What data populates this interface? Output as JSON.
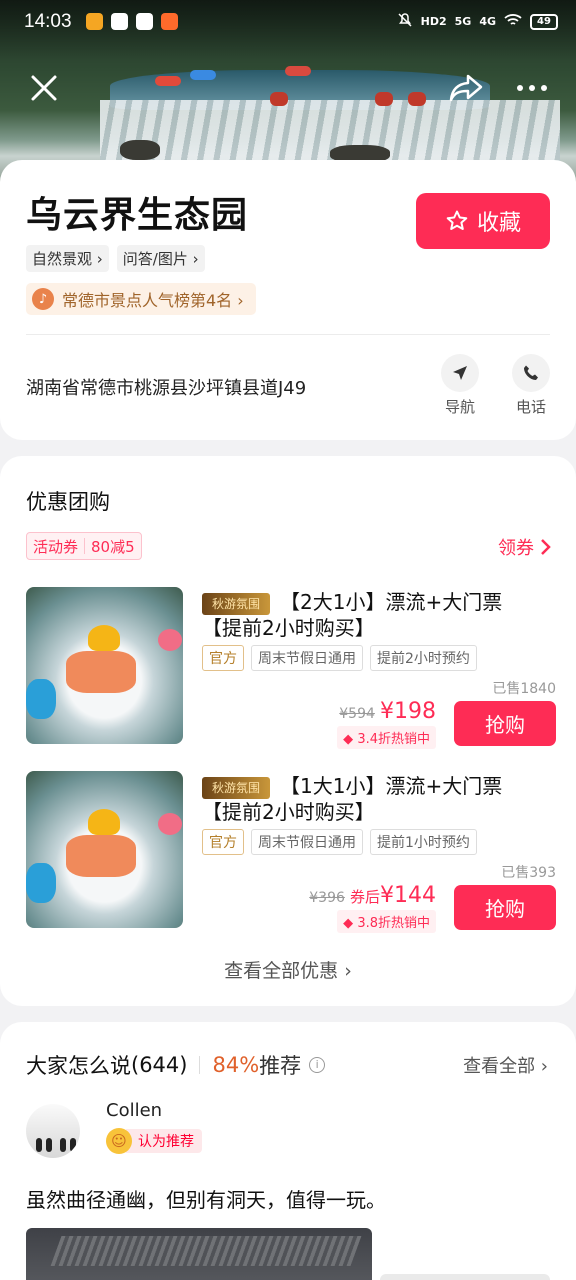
{
  "status_bar": {
    "time": "14:03",
    "battery": "49",
    "signal_labels": [
      "HD2",
      "5G",
      "4G"
    ]
  },
  "place": {
    "name": "乌云界生态园",
    "favorite_label": "收藏",
    "tags": [
      "自然景观 ›",
      "问答/图片 ›"
    ],
    "rank_text": "常德市景点人气榜第4名 ›",
    "address": "湖南省常德市桃源县沙坪镇县道J49",
    "actions": [
      {
        "label": "导航"
      },
      {
        "label": "电话"
      }
    ]
  },
  "deals_section": {
    "title": "优惠团购",
    "coupon_type": "活动券",
    "coupon_value": "80减5",
    "get_coupon": "领券",
    "deals": [
      {
        "logo_text": "秋游氛围",
        "title": "【2大1小】漂流+大门票【提前2小时购买】",
        "tags": [
          "官方",
          "周末节假日通用",
          "提前2小时预约"
        ],
        "sold": "已售1840",
        "orig_price": "¥594",
        "price_prefix": "",
        "price": "¥198",
        "discount": "3.4折热销中",
        "buy_label": "抢购"
      },
      {
        "logo_text": "秋游氛围",
        "title": "【1大1小】漂流+大门票【提前2小时购买】",
        "tags": [
          "官方",
          "周末节假日通用",
          "提前1小时预约"
        ],
        "sold": "已售393",
        "orig_price": "¥396",
        "price_prefix": "券后",
        "price": "¥144",
        "discount": "3.8折热销中",
        "buy_label": "抢购"
      }
    ],
    "view_all": "查看全部优惠 ›"
  },
  "reviews": {
    "title": "大家怎么说",
    "count": "(644)",
    "percent": "84%",
    "recommend_label": "推荐",
    "view_all": "查看全部 ›",
    "first": {
      "user": "Collen",
      "badge": "认为推荐",
      "text": "虽然曲径通幽，但别有洞天，值得一玩。"
    }
  },
  "colors": {
    "accent": "#fe2c55",
    "rank_bg": "#fdf1e6",
    "percent": "#e0612b"
  }
}
